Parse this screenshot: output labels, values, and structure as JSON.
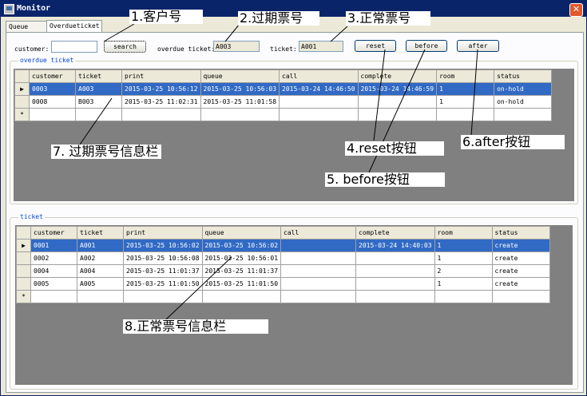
{
  "window": {
    "title": "Monitor",
    "close_glyph": "✕"
  },
  "tabs": [
    {
      "label": "Queue list"
    },
    {
      "label": "Overdueticket"
    }
  ],
  "search": {
    "customer_label": "customer:",
    "customer_value": "",
    "search_button": "search",
    "overdue_label": "overdue ticket:",
    "overdue_value": "A003",
    "ticket_label": "ticket:",
    "ticket_value": "A001",
    "reset_button": "reset",
    "before_button": "before",
    "after_button": "after"
  },
  "overdue": {
    "group_title": "overdue ticket",
    "columns": [
      "customer",
      "ticket",
      "print",
      "queue",
      "call",
      "complete",
      "room",
      "status"
    ],
    "rows": [
      [
        "0003",
        "A003",
        "2015-03-25 10:56:12",
        "2015-03-25 10:56:03",
        "2015-03-24 14:46:50",
        "2015-03-24 14:46:59",
        "1",
        "on-hold"
      ],
      [
        "0008",
        "B003",
        "2015-03-25 11:02:31",
        "2015-03-25 11:01:58",
        "",
        "",
        "1",
        "on-hold"
      ]
    ]
  },
  "normal": {
    "group_title": "ticket",
    "columns": [
      "customer",
      "ticket",
      "print",
      "queue",
      "call",
      "complete",
      "room",
      "status"
    ],
    "rows": [
      [
        "0001",
        "A001",
        "2015-03-25 10:56:02",
        "2015-03-25 10:56:02",
        "",
        "2015-03-24 14:40:03",
        "1",
        "create"
      ],
      [
        "0002",
        "A002",
        "2015-03-25 10:56:08",
        "2015-03-25 10:56:01",
        "",
        "",
        "1",
        "create"
      ],
      [
        "0004",
        "A004",
        "2015-03-25 11:01:37",
        "2015-03-25 11:01:37",
        "",
        "",
        "2",
        "create"
      ],
      [
        "0005",
        "A005",
        "2015-03-25 11:01:50",
        "2015-03-25 11:01:50",
        "",
        "",
        "1",
        "create"
      ]
    ]
  },
  "grid_markers": {
    "current": "▶",
    "new": "*"
  },
  "annotations": {
    "a1": "1.客户号",
    "a2": "2.过期票号",
    "a3": "3.正常票号",
    "a4": "4.reset按钮",
    "a5": "5. before按钮",
    "a6": "6.after按钮",
    "a7": "7. 过期票号信息栏",
    "a8": "8.正常票号信息栏"
  },
  "colors": {
    "title_bar": "#0a246a",
    "selection": "#316ac5",
    "window_bg": "#ece9d8"
  }
}
